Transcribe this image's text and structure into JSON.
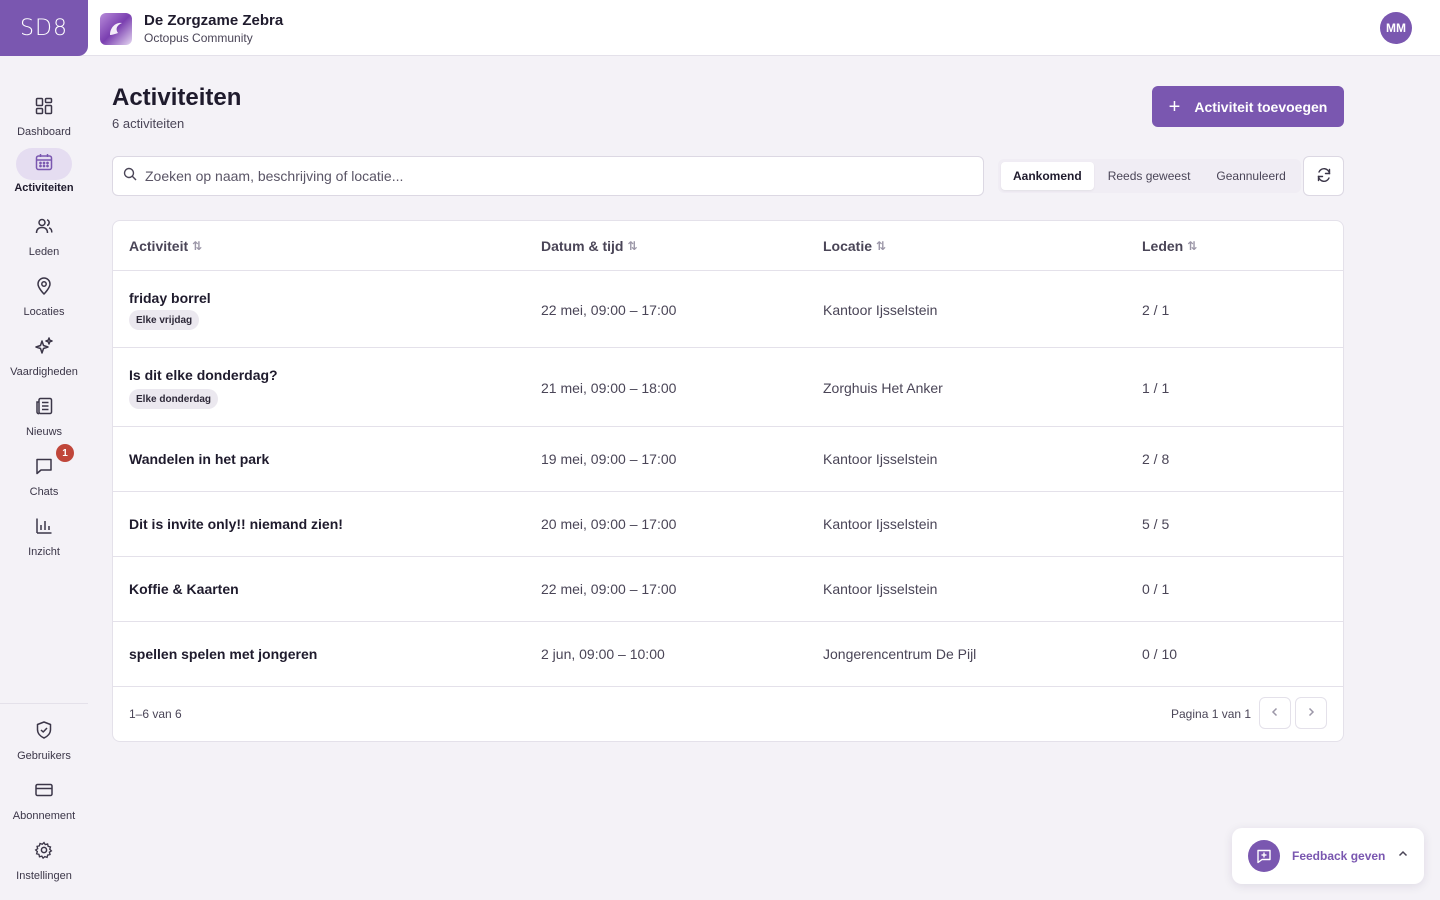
{
  "brand": {
    "logo_text": "SD8"
  },
  "org": {
    "name": "De Zorgzame Zebra",
    "subtitle": "Octopus Community"
  },
  "user": {
    "initials": "MM"
  },
  "sidebar": {
    "items": [
      {
        "label": "Dashboard",
        "icon": "dashboard-icon"
      },
      {
        "label": "Activiteiten",
        "icon": "calendar-icon",
        "active": true
      },
      {
        "label": "Leden",
        "icon": "users-icon"
      },
      {
        "label": "Locaties",
        "icon": "map-pin-icon"
      },
      {
        "label": "Vaardigheden",
        "icon": "sparkles-icon"
      },
      {
        "label": "Nieuws",
        "icon": "newspaper-icon"
      },
      {
        "label": "Chats",
        "icon": "chat-icon",
        "badge": "1"
      },
      {
        "label": "Inzicht",
        "icon": "bar-chart-icon"
      }
    ],
    "bottom_items": [
      {
        "label": "Gebruikers",
        "icon": "shield-icon"
      },
      {
        "label": "Abonnement",
        "icon": "credit-card-icon"
      },
      {
        "label": "Instellingen",
        "icon": "gear-icon"
      }
    ]
  },
  "page": {
    "title": "Activiteiten",
    "subtitle": "6 activiteiten",
    "add_button": "Activiteit toevoegen"
  },
  "search": {
    "placeholder": "Zoeken op naam, beschrijving of locatie...",
    "value": ""
  },
  "filters": {
    "options": [
      "Aankomend",
      "Reeds geweest",
      "Geannuleerd"
    ],
    "selected": "Aankomend"
  },
  "table": {
    "columns": [
      "Activiteit",
      "Datum & tijd",
      "Locatie",
      "Leden"
    ],
    "rows": [
      {
        "name": "friday borrel",
        "tag": "Elke vrijdag",
        "date": "22 mei, 09:00 – 17:00",
        "location": "Kantoor Ijsselstein",
        "members": "2 / 1"
      },
      {
        "name": "Is dit elke donderdag?",
        "tag": "Elke donderdag",
        "date": "21 mei, 09:00 – 18:00",
        "location": "Zorghuis Het Anker",
        "members": "1 / 1"
      },
      {
        "name": "Wandelen in het park",
        "tag": "",
        "date": "19 mei, 09:00 – 17:00",
        "location": "Kantoor Ijsselstein",
        "members": "2 / 8"
      },
      {
        "name": "Dit is invite only!! niemand zien!",
        "tag": "",
        "date": "20 mei, 09:00 – 17:00",
        "location": "Kantoor Ijsselstein",
        "members": "5 / 5"
      },
      {
        "name": "Koffie & Kaarten",
        "tag": "",
        "date": "22 mei, 09:00 – 17:00",
        "location": "Kantoor Ijsselstein",
        "members": "0 / 1"
      },
      {
        "name": "spellen spelen met jongeren",
        "tag": "",
        "date": "2 jun, 09:00 – 10:00",
        "location": "Jongerencentrum De Pijl",
        "members": "0 / 10"
      }
    ],
    "range_text": "1–6 van 6",
    "page_text": "Pagina 1 van 1"
  },
  "feedback": {
    "label": "Feedback geven"
  },
  "colors": {
    "accent": "#7a57b0",
    "badge": "#c0463a",
    "background": "#f4f2f7"
  }
}
